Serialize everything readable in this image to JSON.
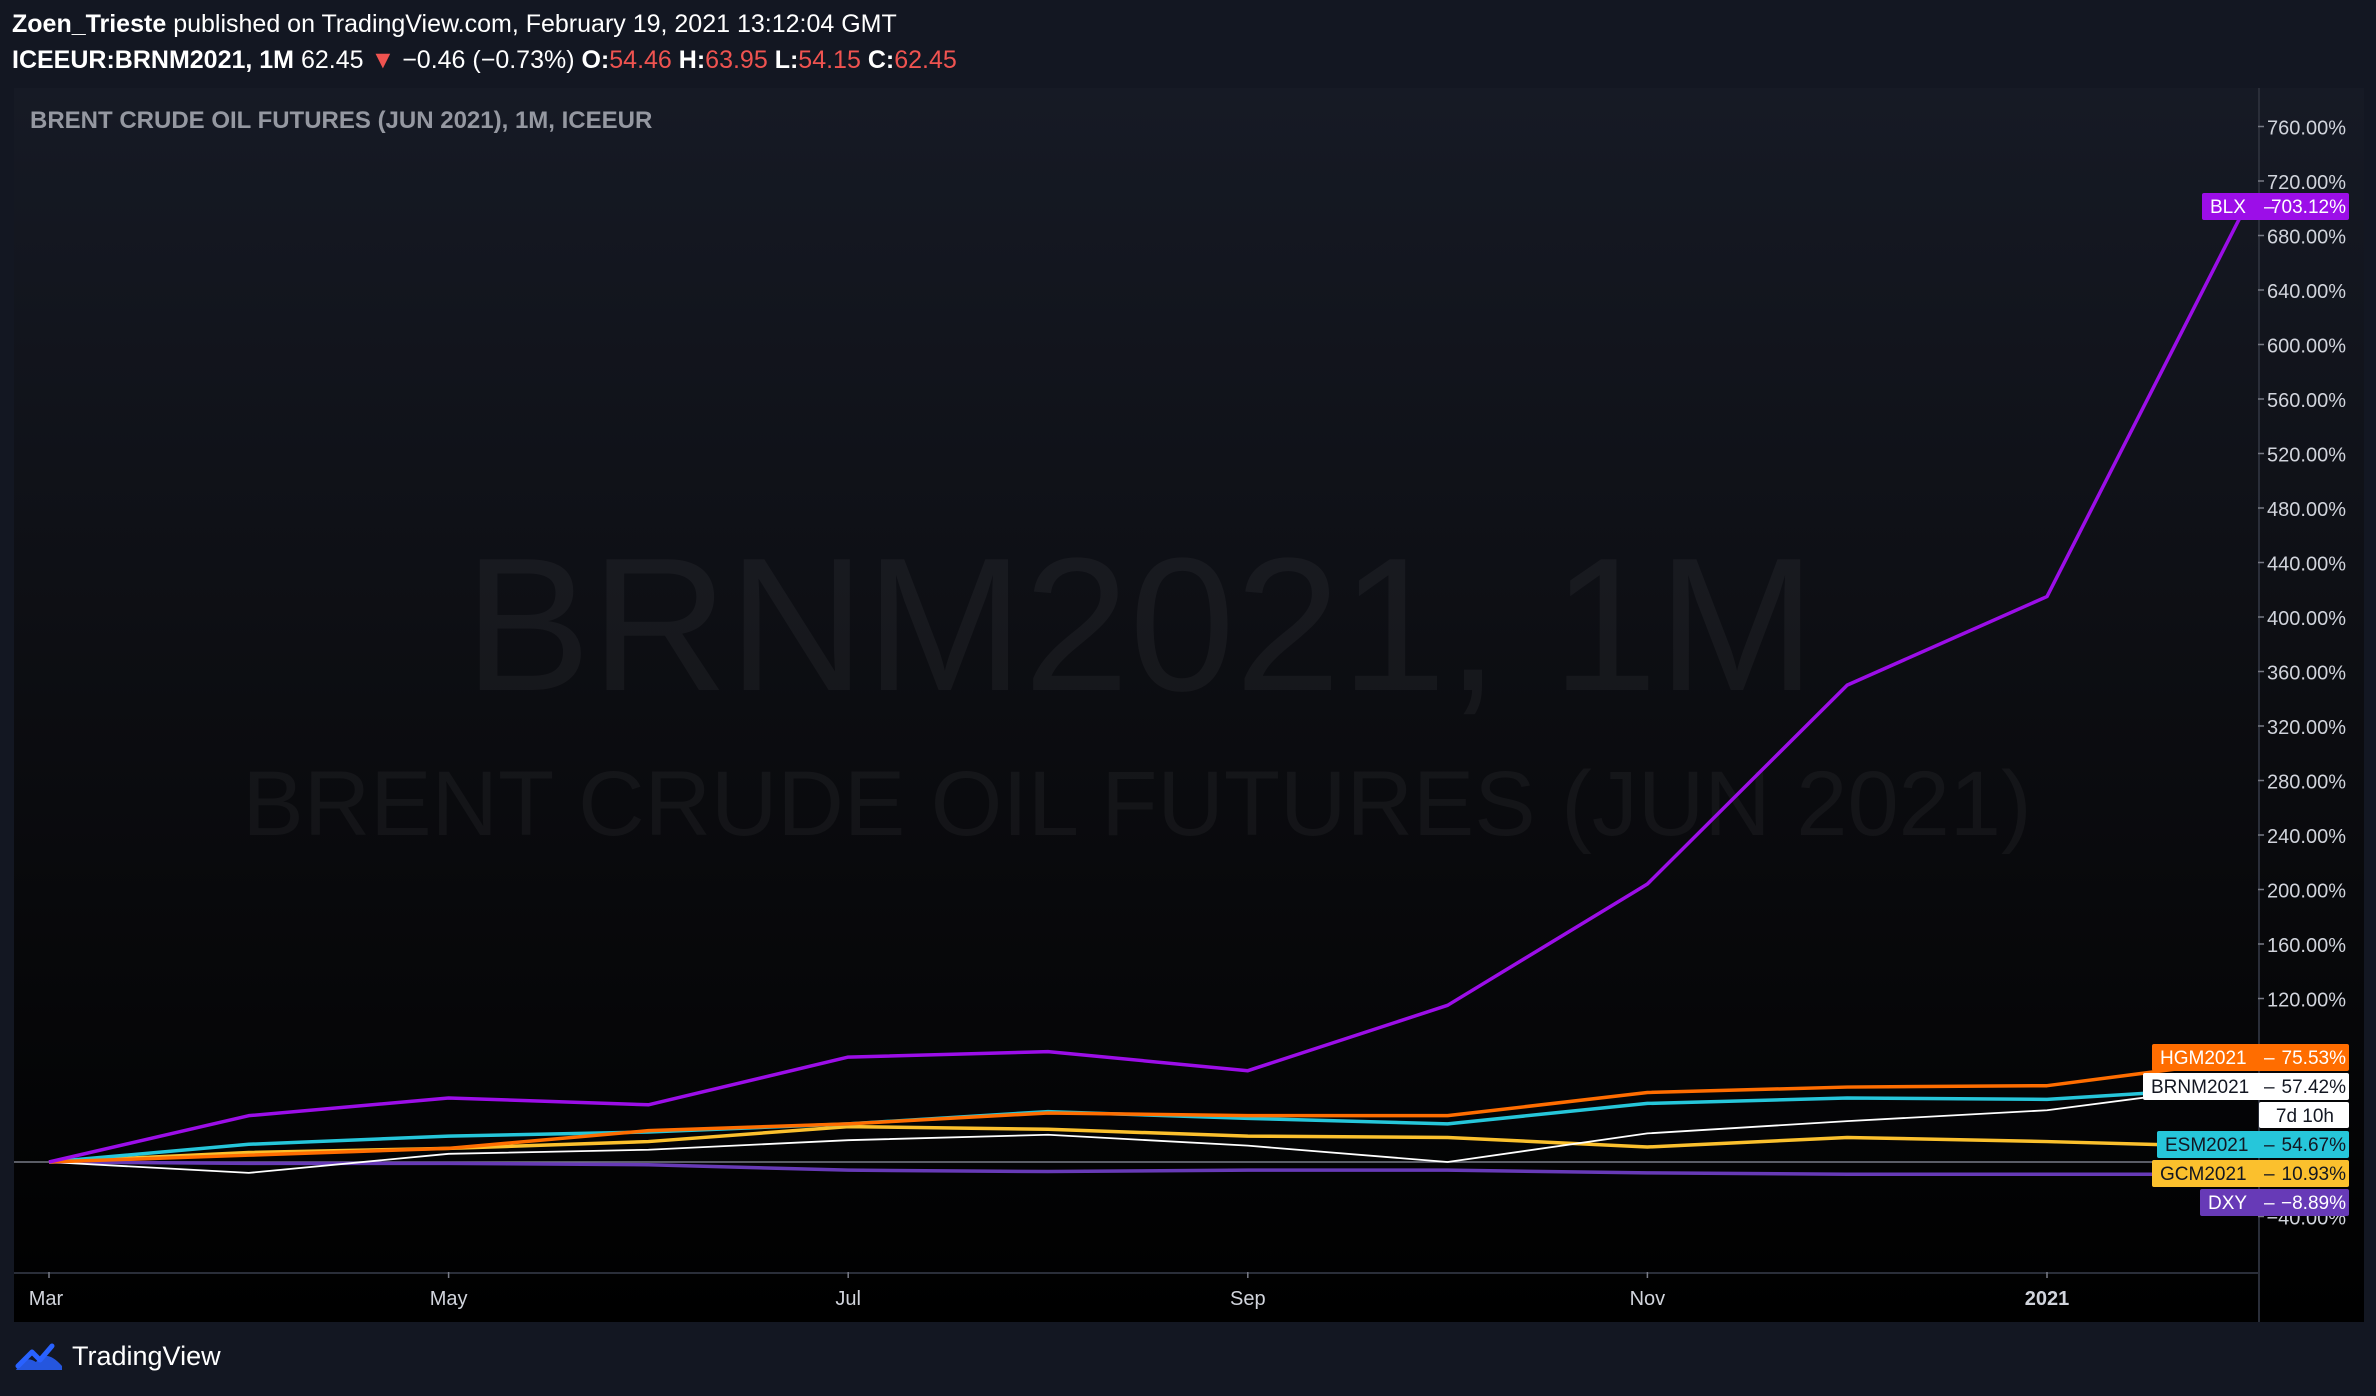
{
  "header": {
    "author": "Zoen_Trieste",
    "published_text": "published on TradingView.com, February 19, 2021 13:12:04 GMT",
    "symbol": "ICEEUR:BRNM2021, 1M",
    "last": "62.45",
    "change": "−0.46 (−0.73%)",
    "open_label": "O:",
    "open": "54.46",
    "high_label": "H:",
    "high": "63.95",
    "low_label": "L:",
    "low": "54.15",
    "close_label": "C:",
    "close": "62.45"
  },
  "chart_title": "BRENT CRUDE OIL FUTURES (JUN 2021), 1M, ICEEUR",
  "watermark": {
    "line1": "BRNM2021, 1M",
    "line2": "BRENT CRUDE OIL FUTURES (JUN 2021)"
  },
  "footer": {
    "brand": "TradingView"
  },
  "colors": {
    "background": "#131722",
    "BLX": "#9c0ee8",
    "HGM2021": "#ff6d00",
    "BRNM2021": "#ffffff",
    "ESM2021": "#26c6da",
    "GCM2021": "#fbc02d",
    "DXY": "#673ab7",
    "down_red": "#ef5350"
  },
  "chart_data": {
    "type": "line",
    "title": "BRENT CRUDE OIL FUTURES (JUN 2021), 1M, ICEEUR",
    "y_unit": "%",
    "ylim": [
      -80,
      780
    ],
    "y_ticks": [
      "760.00%",
      "720.00%",
      "680.00%",
      "640.00%",
      "600.00%",
      "560.00%",
      "520.00%",
      "480.00%",
      "440.00%",
      "400.00%",
      "360.00%",
      "320.00%",
      "280.00%",
      "240.00%",
      "200.00%",
      "160.00%",
      "120.00%",
      "−40.00%"
    ],
    "y_tick_values": [
      760,
      720,
      680,
      640,
      600,
      560,
      520,
      480,
      440,
      400,
      360,
      320,
      280,
      240,
      200,
      160,
      120,
      -40
    ],
    "x_labels": [
      "Mar",
      "May",
      "Jul",
      "Sep",
      "Nov",
      "2021",
      "Mar",
      "May",
      "Jul",
      "Sep",
      "Nov",
      "202"
    ],
    "x_label_month_index": [
      0,
      2,
      4,
      6,
      8,
      10,
      12,
      14,
      16,
      18,
      20,
      22
    ],
    "x": [
      "2020-03",
      "2020-04",
      "2020-05",
      "2020-06",
      "2020-07",
      "2020-08",
      "2020-09",
      "2020-10",
      "2020-11",
      "2020-12",
      "2021-01",
      "2021-02"
    ],
    "series": [
      {
        "name": "BLX",
        "color": "#9c0ee8",
        "width": 3.5,
        "last_label": "703.12%",
        "values": [
          0,
          34,
          47,
          42,
          77,
          81,
          67,
          115,
          204,
          350,
          415,
          703
        ]
      },
      {
        "name": "HGM2021",
        "color": "#ff6d00",
        "width": 3.5,
        "last_label": "75.53%",
        "values": [
          0,
          5,
          10,
          23,
          28,
          36,
          34,
          34,
          51,
          55,
          56,
          75
        ]
      },
      {
        "name": "BRNM2021",
        "color": "#ffffff",
        "width": 1.8,
        "last_label": "57.42%",
        "values": [
          0,
          -8,
          6,
          9,
          16,
          20,
          12,
          0,
          21,
          30,
          38,
          57
        ]
      },
      {
        "name": "ESM2021",
        "color": "#26c6da",
        "width": 3.5,
        "last_label": "54.67%",
        "values": [
          0,
          13,
          19,
          22,
          28,
          37,
          32,
          28,
          43,
          47,
          46,
          55
        ]
      },
      {
        "name": "GCM2021",
        "color": "#fbc02d",
        "width": 3.5,
        "last_label": "10.93%",
        "values": [
          0,
          7,
          10,
          15,
          26,
          24,
          19,
          18,
          11,
          18,
          15,
          11
        ]
      },
      {
        "name": "DXY",
        "color": "#673ab7",
        "width": 3.5,
        "last_label": "−8.89%",
        "values": [
          0,
          -1,
          -1,
          -2,
          -6,
          -7,
          -6,
          -6,
          -8,
          -9,
          -9,
          -9
        ]
      }
    ],
    "extra_labels": [
      {
        "text": "7d 10h"
      }
    ],
    "zero_line": 0,
    "grid": false,
    "legend": "price-axis labels"
  }
}
